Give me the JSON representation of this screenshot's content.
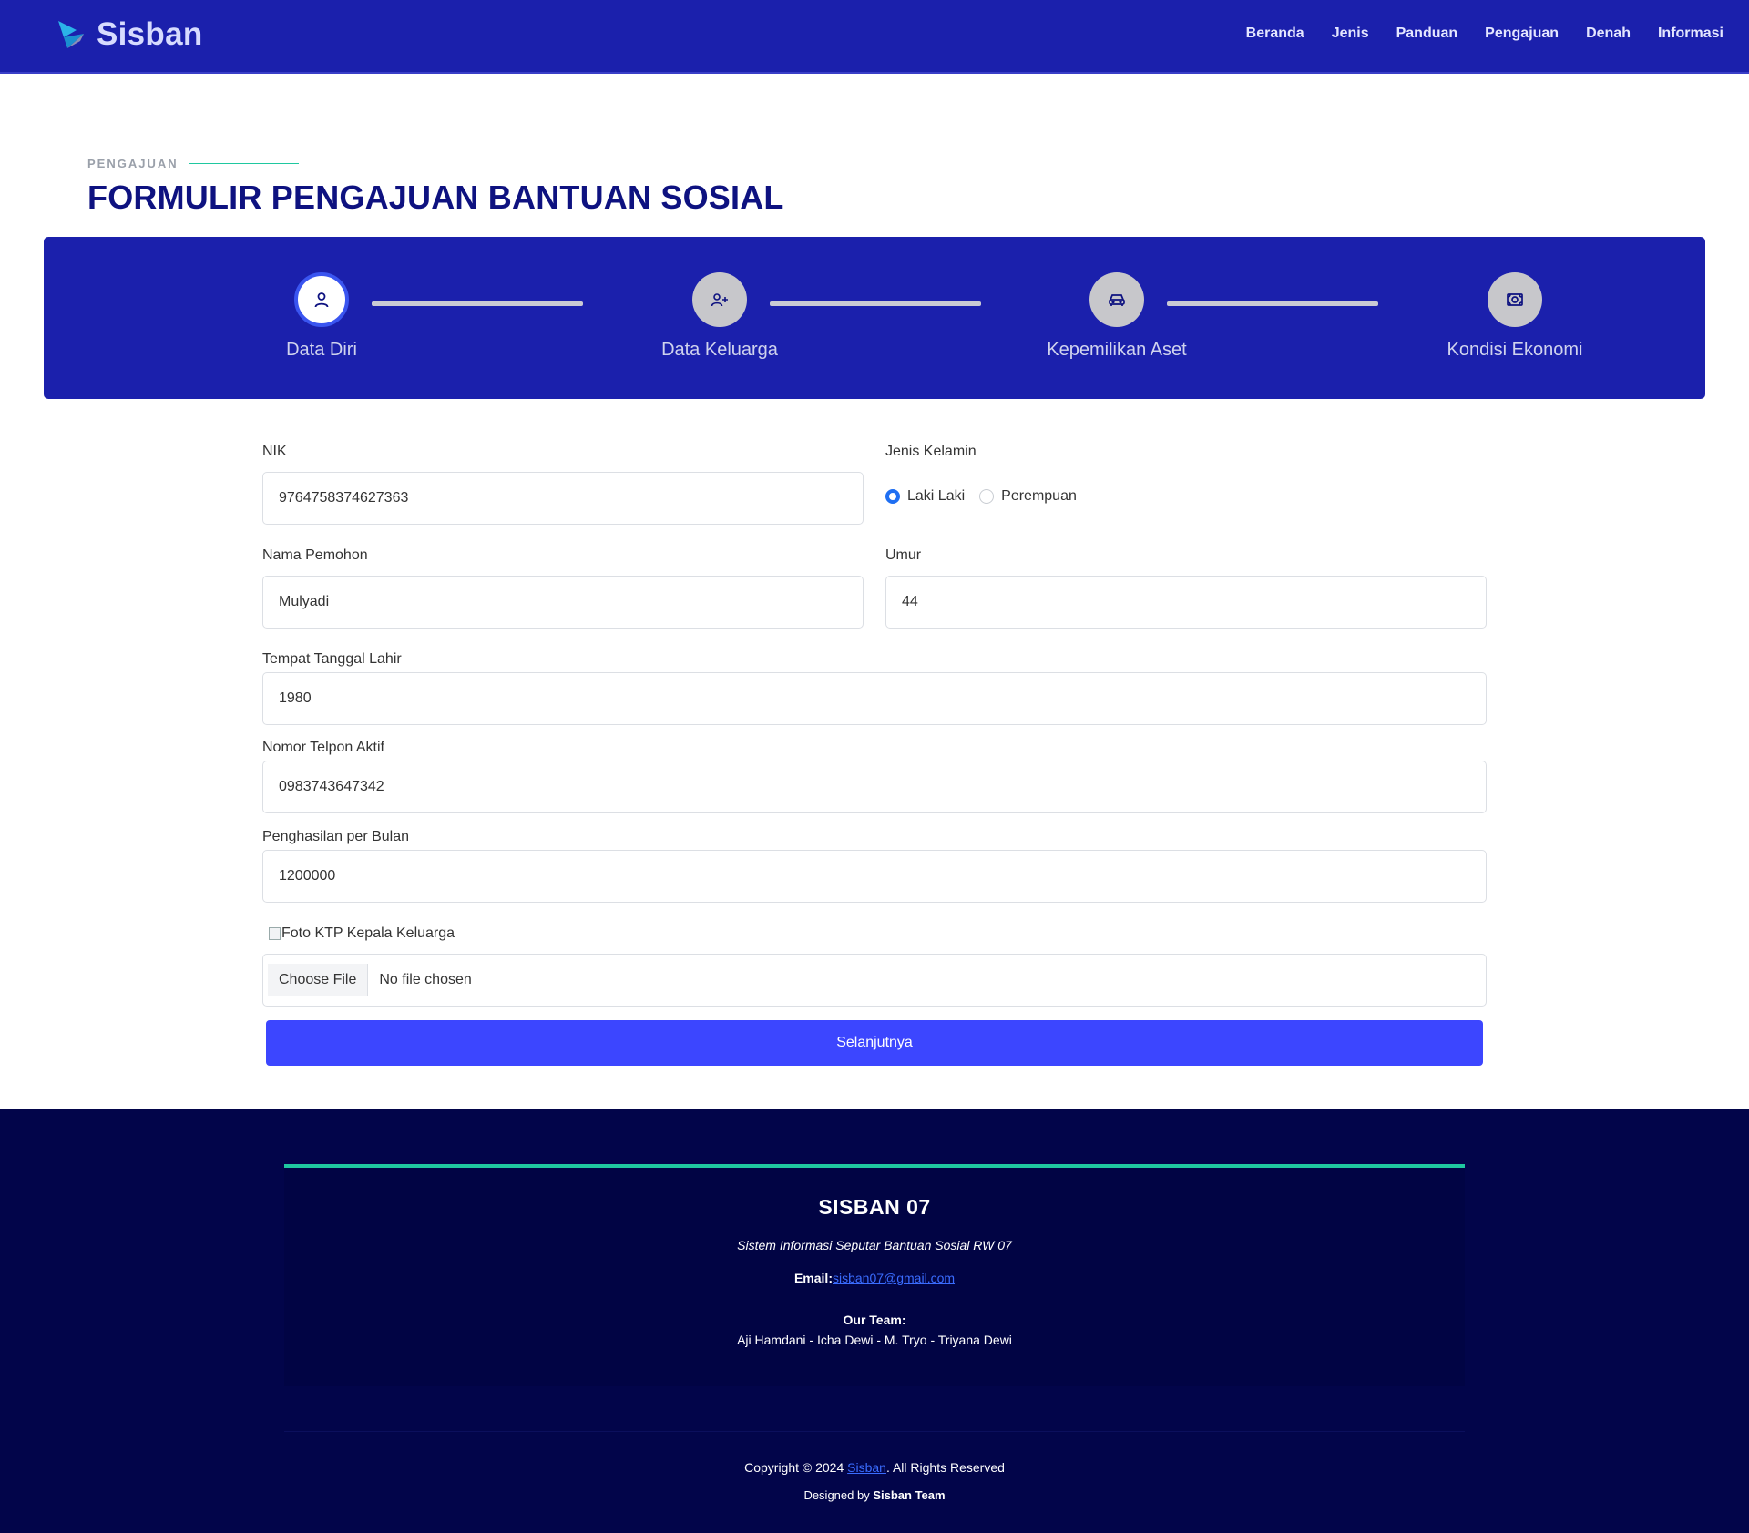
{
  "brand": {
    "name": "Sisban"
  },
  "nav": [
    "Beranda",
    "Jenis",
    "Panduan",
    "Pengajuan",
    "Denah",
    "Informasi"
  ],
  "section": {
    "eyebrow": "PENGAJUAN",
    "title": "FORMULIR PENGAJUAN BANTUAN SOSIAL"
  },
  "steps": [
    {
      "label": "Data Diri",
      "icon": "user-icon",
      "active": true
    },
    {
      "label": "Data Keluarga",
      "icon": "user-plus-icon",
      "active": false
    },
    {
      "label": "Kepemilikan Aset",
      "icon": "car-icon",
      "active": false
    },
    {
      "label": "Kondisi Ekonomi",
      "icon": "money-icon",
      "active": false
    }
  ],
  "form": {
    "nik_label": "NIK",
    "nik_value": "9764758374627363",
    "gender_label": "Jenis Kelamin",
    "gender_options": [
      "Laki Laki",
      "Perempuan"
    ],
    "gender_selected": "Laki Laki",
    "name_label": "Nama Pemohon",
    "name_value": "Mulyadi",
    "age_label": "Umur",
    "age_value": "44",
    "birth_label": "Tempat Tanggal Lahir",
    "birth_value": "1980",
    "phone_label": "Nomor Telpon Aktif",
    "phone_value": "0983743647342",
    "income_label": "Penghasilan per Bulan",
    "income_value": "1200000",
    "ktp_alt": "Foto KTP Kepala Keluarga",
    "file_button": "Choose File",
    "file_status": "No file chosen",
    "submit": "Selanjutnya"
  },
  "footer": {
    "title": "SISBAN 07",
    "description": "Sistem Informasi Seputar Bantuan Sosial RW 07",
    "email_label": "Email:",
    "email": "sisban07@gmail.com",
    "team_heading": "Our Team:",
    "team_members": "Aji Hamdani - Icha Dewi - M. Tryo - Triyana Dewi",
    "copyright_prefix": "Copyright © 2024 ",
    "copyright_link": "Sisban",
    "copyright_suffix": ". All Rights Reserved",
    "designed_prefix": "Designed by ",
    "designed_by": "Sisban Team"
  },
  "colors": {
    "header_bg": "#1b20ac",
    "title": "#0e1280",
    "accent": "#1fc8a0",
    "submit": "#3c46ff",
    "footer_bg": "#02054a"
  }
}
